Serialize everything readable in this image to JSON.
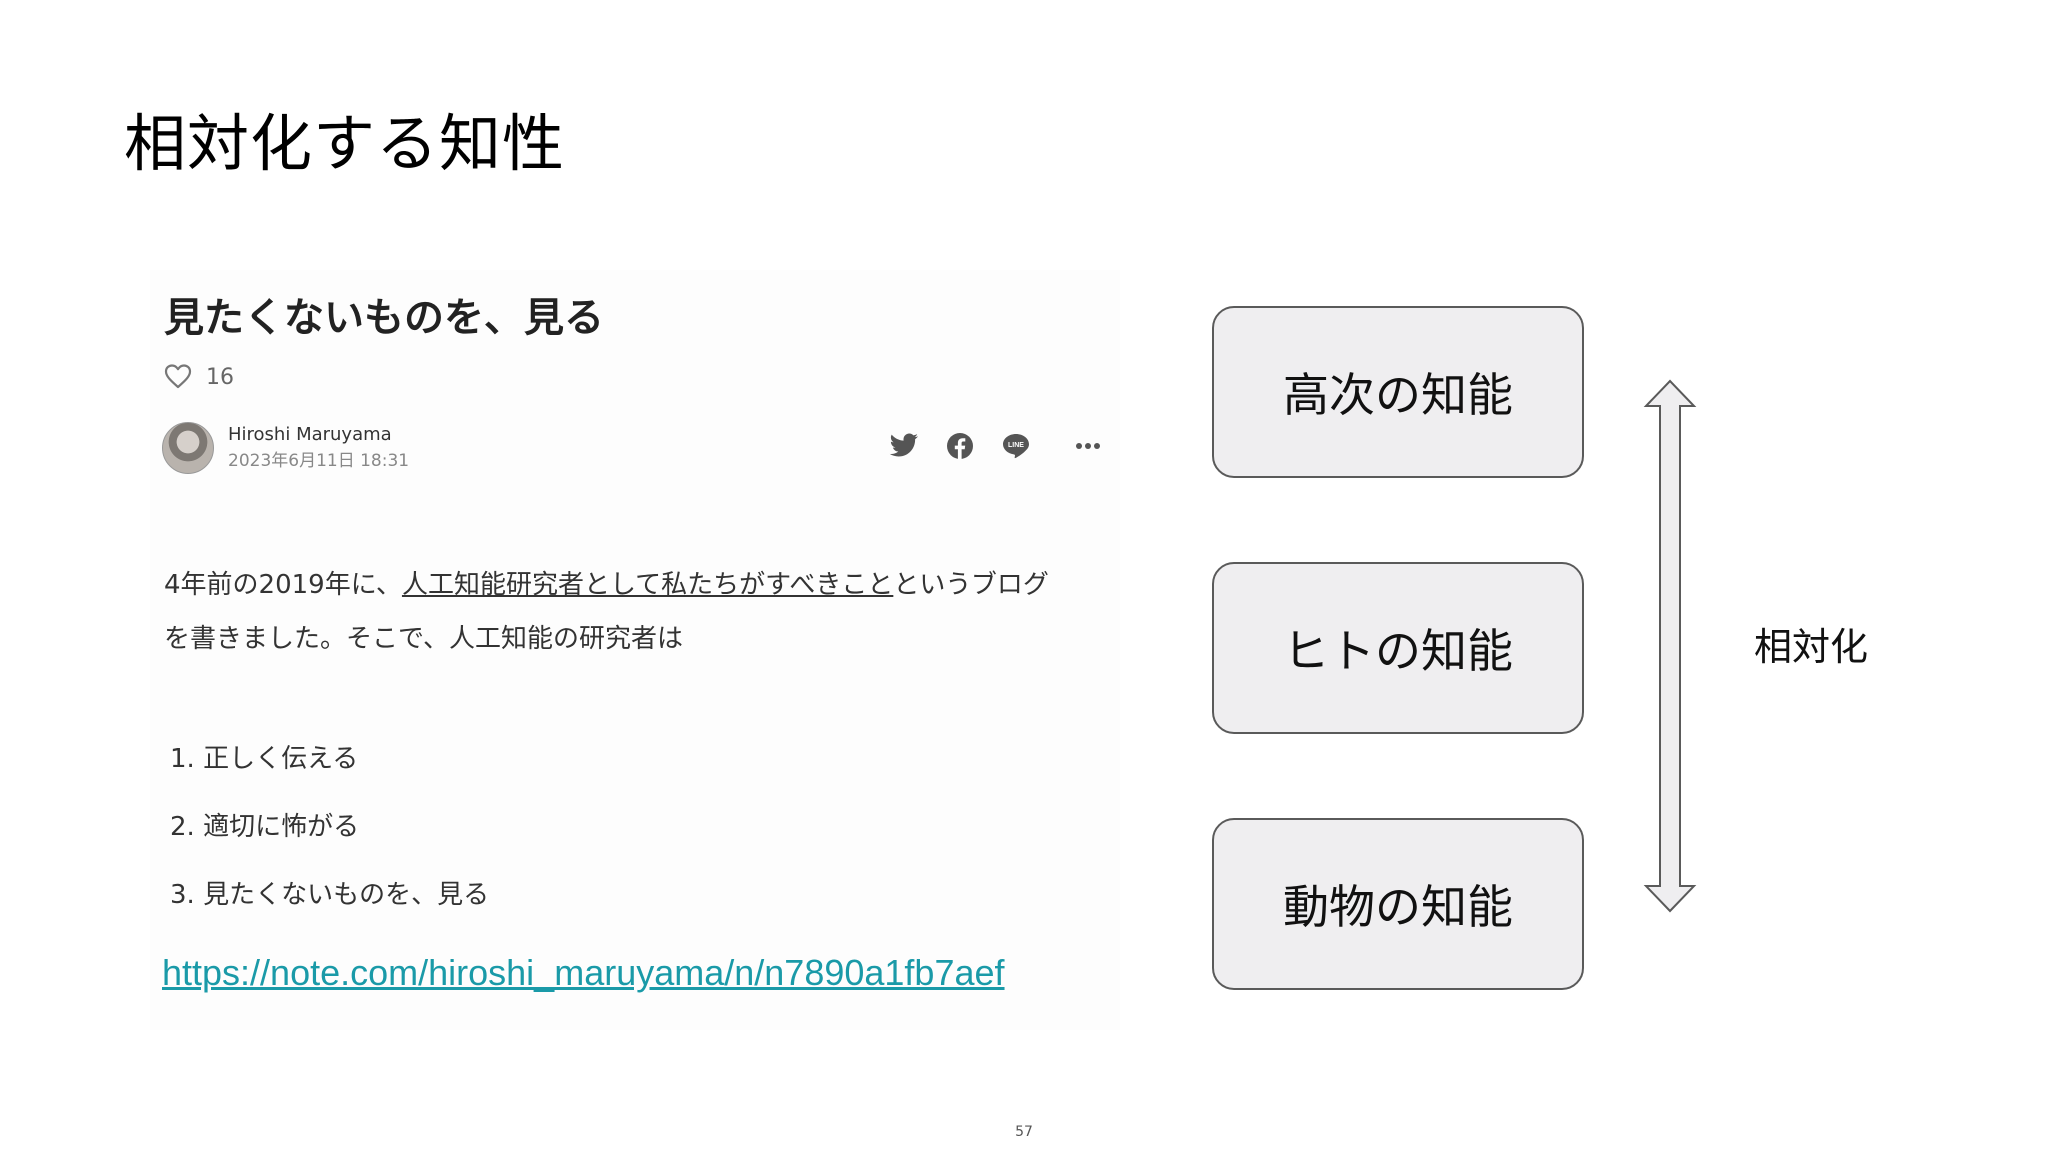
{
  "slide": {
    "title": "相対化する知性",
    "page_number": "57"
  },
  "blog": {
    "title": "見たくないものを、見る",
    "like_count": "16",
    "author_name": "Hiroshi Maruyama",
    "date": "2023年6月11日 18:31",
    "share_icons": [
      "twitter-icon",
      "facebook-icon",
      "line-icon",
      "more-icon"
    ],
    "body_line1_prefix": "4年前の2019年に、",
    "body_link": "人工知能研究者として私たちがすべきこと",
    "body_line1_suffix": "というブログ",
    "body_line2": "を書きました。そこで、人工知能の研究者は",
    "list": [
      "1. 正しく伝える",
      "2. 適切に怖がる",
      "3. 見たくないものを、見る"
    ]
  },
  "link": {
    "url": "https://note.com/hiroshi_maruyama/n/n7890a1fb7aef"
  },
  "diagram": {
    "levels": [
      "高次の知能",
      "ヒトの知能",
      "動物の知能"
    ],
    "arrow_label": "相対化",
    "colors": {
      "box_fill": "#efeef0",
      "box_stroke": "#5a5a5a",
      "link": "#1a9aa8"
    }
  }
}
